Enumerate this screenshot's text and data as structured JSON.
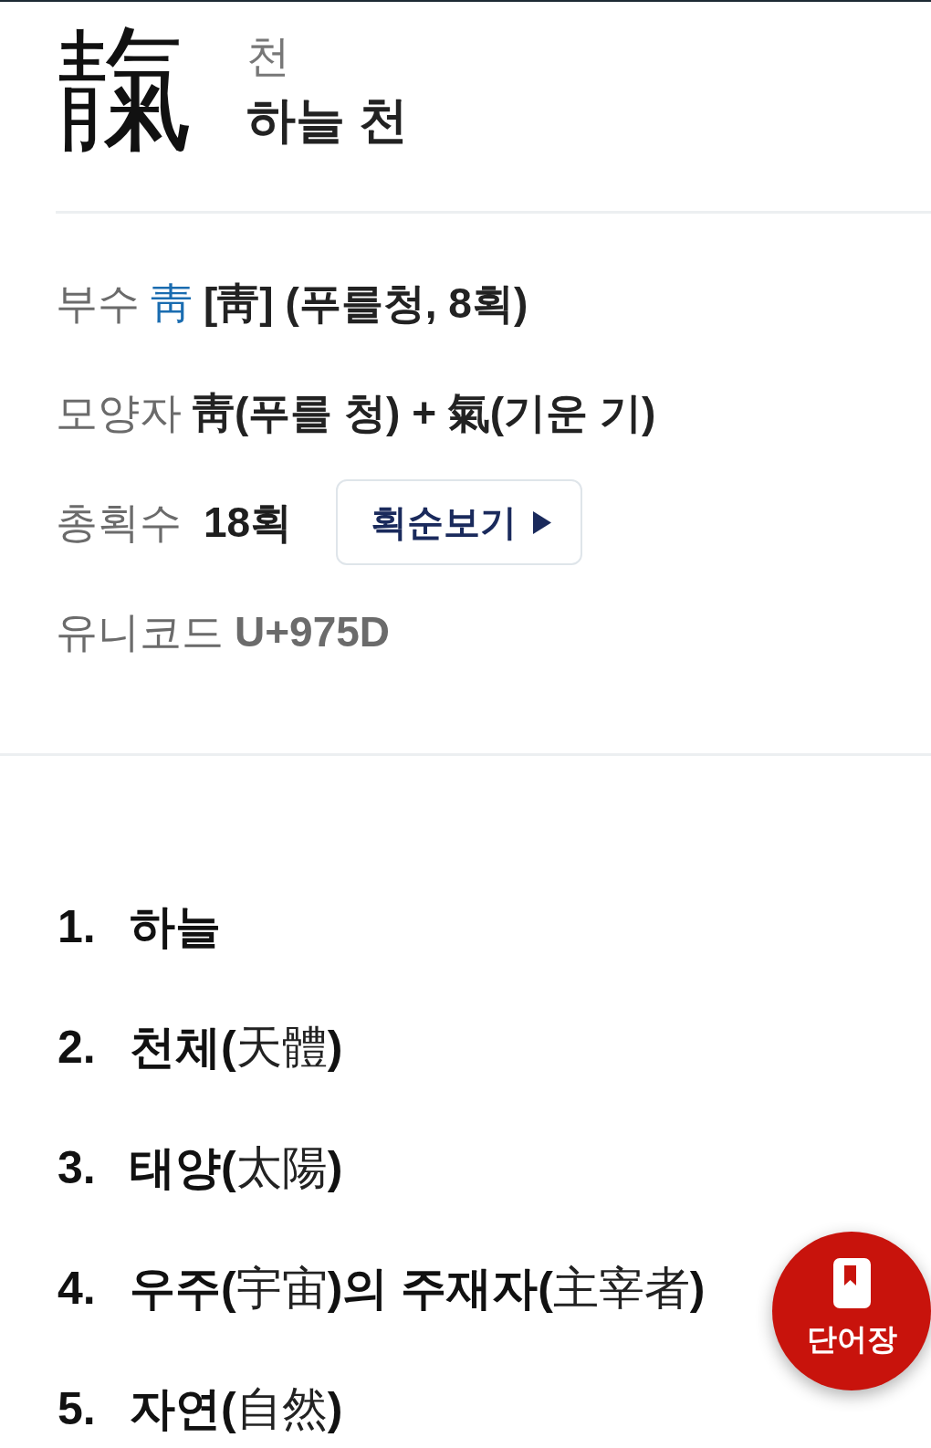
{
  "header": {
    "character": "靝",
    "reading": "천",
    "meaning": "하늘 천"
  },
  "info": [
    {
      "kind": "radical",
      "label": "부수",
      "link": "靑",
      "value": "[靑] (푸를청, 8획)"
    },
    {
      "kind": "shape",
      "label": "모양자",
      "value": "靑(푸를 청) + 氣(기운 기)"
    },
    {
      "kind": "strokes",
      "label": "총획수",
      "value": "18획",
      "button": "획순보기"
    },
    {
      "kind": "unicode",
      "label": "유니코드",
      "value": "U+975D"
    }
  ],
  "meanings": [
    {
      "number": "1.",
      "parts": [
        {
          "kind": "hangul",
          "text": "하늘"
        }
      ]
    },
    {
      "number": "2.",
      "parts": [
        {
          "kind": "hangul",
          "text": "천체("
        },
        {
          "kind": "hanja",
          "text": "天體"
        },
        {
          "kind": "hangul",
          "text": ")"
        }
      ]
    },
    {
      "number": "3.",
      "parts": [
        {
          "kind": "hangul",
          "text": "태양("
        },
        {
          "kind": "hanja",
          "text": "太陽"
        },
        {
          "kind": "hangul",
          "text": ")"
        }
      ]
    },
    {
      "number": "4.",
      "parts": [
        {
          "kind": "hangul",
          "text": "우주("
        },
        {
          "kind": "hanja",
          "text": "宇宙"
        },
        {
          "kind": "hangul",
          "text": ")의 주재자("
        },
        {
          "kind": "hanja",
          "text": "主宰者"
        },
        {
          "kind": "hangul",
          "text": ")"
        }
      ]
    },
    {
      "number": "5.",
      "parts": [
        {
          "kind": "hangul",
          "text": "자연("
        },
        {
          "kind": "hanja",
          "text": "自然"
        },
        {
          "kind": "hangul",
          "text": ")"
        }
      ]
    }
  ],
  "vocabulary_button": {
    "label": "단어장"
  }
}
